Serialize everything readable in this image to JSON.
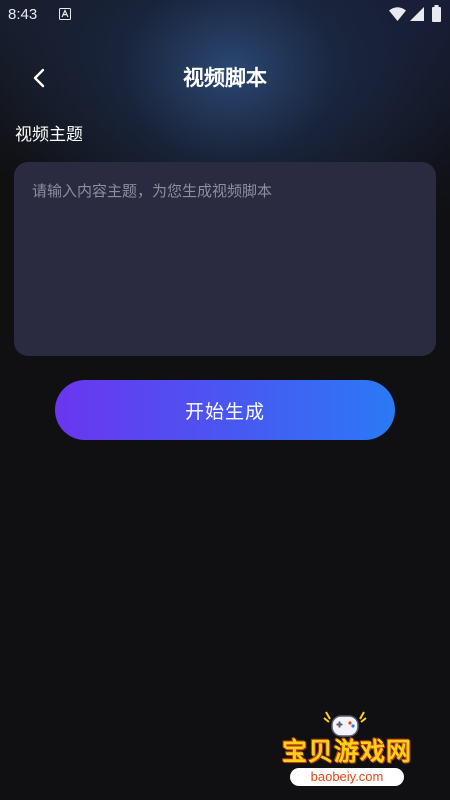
{
  "status_bar": {
    "time": "8:43"
  },
  "header": {
    "title": "视频脚本"
  },
  "form": {
    "topic_label": "视频主题",
    "topic_placeholder": "请输入内容主题，为您生成视频脚本",
    "topic_value": "",
    "generate_label": "开始生成"
  },
  "watermark": {
    "name": "宝贝游戏网",
    "domain": "baobeiy.com"
  },
  "colors": {
    "background": "#101012",
    "input_background": "#2a2b40",
    "button_gradient_start": "#6a36f0",
    "button_gradient_end": "#2a7af4"
  },
  "icons": {
    "back": "chevron-left-icon",
    "wifi": "wifi-icon",
    "signal": "cell-signal-icon",
    "battery": "battery-icon",
    "notification": "a-notification-icon"
  }
}
